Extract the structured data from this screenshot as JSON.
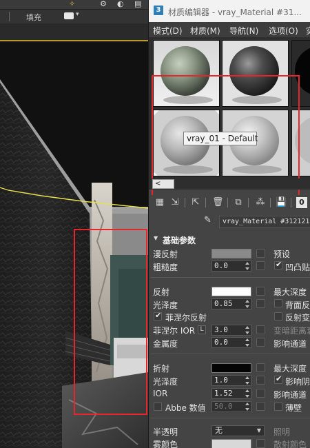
{
  "toolbar": {
    "fill_label": "填充"
  },
  "window": {
    "title": "材质编辑器 - vray_Material #31..."
  },
  "menu": [
    {
      "label": "模式(D)"
    },
    {
      "label": "材质(M)"
    },
    {
      "label": "导航(N)"
    },
    {
      "label": "选项(O)"
    },
    {
      "label": "实"
    }
  ],
  "sample_slots": {
    "tooltip": "vray_01 - Default"
  },
  "scroll": {
    "left_arrow": "<"
  },
  "material_name": "vray_Material #312121",
  "rollout": {
    "title": "基础参数"
  },
  "params": {
    "diffuse": {
      "label": "漫反射",
      "color": "#8a8a8a"
    },
    "roughness": {
      "label": "粗糙度",
      "value": "0.0"
    },
    "preset_label": "预设",
    "bump_label": "凹凸贴",
    "reflect": {
      "label": "反射",
      "color": "#ffffff"
    },
    "max_depth_1": "最大深度",
    "glossiness": {
      "label": "光泽度",
      "value": "0.85"
    },
    "backface_label": "背面反",
    "fresnel": {
      "label": "菲涅尔反射"
    },
    "reflect_var_label": "反射变",
    "fresnel_ior": {
      "label": "菲涅尔 IOR",
      "lock": "L",
      "value": "3.0"
    },
    "dim_distance_label": "变暗距离衰",
    "metalness": {
      "label": "金属度",
      "value": "0.0"
    },
    "affect_channel_1": "影响通道",
    "refract": {
      "label": "折射",
      "color": "#050505"
    },
    "max_depth_2": "最大深度",
    "refr_gloss": {
      "label": "光泽度",
      "value": "1.0"
    },
    "affect_shadow_label": "影响阴",
    "ior": {
      "label": "IOR",
      "value": "1.52"
    },
    "affect_channel_2": "影响通道",
    "abbe": {
      "label": "Abbe 数值",
      "value": "50.0"
    },
    "thin_wall_label": "薄壁",
    "translucency": {
      "label": "半透明",
      "value": "无"
    },
    "illumination_label": "照明",
    "fog_color": {
      "label": "雾颜色",
      "color": "#d8d8d8"
    },
    "scatter_color_label": "散射颜色"
  },
  "colors": {
    "highlight_red": "#e8262a",
    "viewport_line": "#e8e04a"
  }
}
